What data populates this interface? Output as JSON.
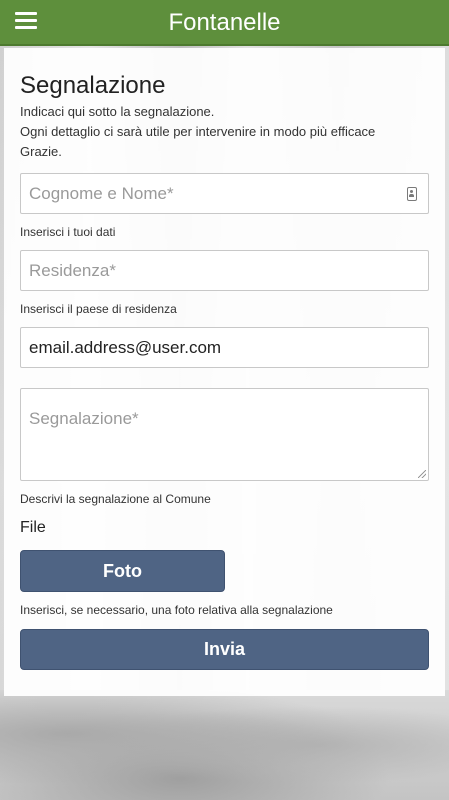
{
  "header": {
    "title": "Fontanelle"
  },
  "form": {
    "title": "Segnalazione",
    "intro_lines": [
      "Indicaci qui sotto la segnalazione.",
      "Ogni dettaglio ci sarà utile per intervenire in modo più efficace",
      "Grazie."
    ],
    "name_placeholder": "Cognome e Nome*",
    "name_help": "Inserisci i tuoi dati",
    "residence_placeholder": "Residenza*",
    "residence_help": "Inserisci il paese di residenza",
    "email_value": "email.address@user.com",
    "report_placeholder": "Segnalazione*",
    "report_help": "Descrivi la segnalazione al Comune",
    "file_label": "File",
    "photo_button": "Foto",
    "photo_help": "Inserisci, se necessario, una foto relativa alla segnalazione",
    "submit_button": "Invia"
  },
  "icons": {
    "menu": "hamburger-menu-icon",
    "contact": "contact-card-icon"
  },
  "colors": {
    "header": "#5e8f3c",
    "button": "#4f6484"
  }
}
